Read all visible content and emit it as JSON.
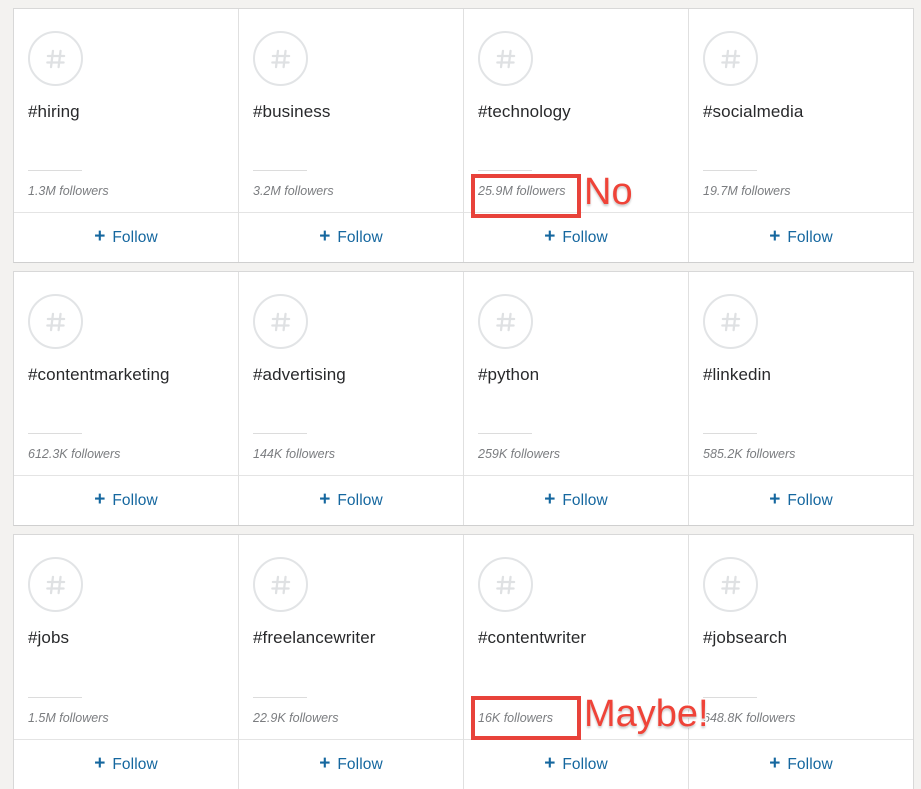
{
  "page": {
    "background_color": "#f3f2f0",
    "card_background": "#ffffff",
    "accent_blue": "#15679f",
    "annotation_red": "#e8423a"
  },
  "follow": {
    "plus": "+",
    "label": "Follow"
  },
  "icon": {
    "name": "hashtag-icon",
    "glyph": "#"
  },
  "rows": [
    {
      "cards": [
        {
          "hashtag": "#hiring",
          "followers": "1.3M followers"
        },
        {
          "hashtag": "#business",
          "followers": "3.2M followers"
        },
        {
          "hashtag": "#technology",
          "followers": "25.9M followers"
        },
        {
          "hashtag": "#socialmedia",
          "followers": "19.7M followers"
        }
      ]
    },
    {
      "cards": [
        {
          "hashtag": "#contentmarketing",
          "followers": "612.3K followers"
        },
        {
          "hashtag": "#advertising",
          "followers": "144K followers"
        },
        {
          "hashtag": "#python",
          "followers": "259K followers"
        },
        {
          "hashtag": "#linkedin",
          "followers": "585.2K followers"
        }
      ]
    },
    {
      "cards": [
        {
          "hashtag": "#jobs",
          "followers": "1.5M followers"
        },
        {
          "hashtag": "#freelancewriter",
          "followers": "22.9K followers"
        },
        {
          "hashtag": "#contentwriter",
          "followers": "16K followers"
        },
        {
          "hashtag": "#jobsearch",
          "followers": "648.8K followers"
        }
      ]
    }
  ],
  "annotations": [
    {
      "id": "no",
      "text": "No",
      "targets": "#technology followers count"
    },
    {
      "id": "maybe",
      "text": "Maybe!",
      "targets": "#contentwriter followers count"
    }
  ]
}
